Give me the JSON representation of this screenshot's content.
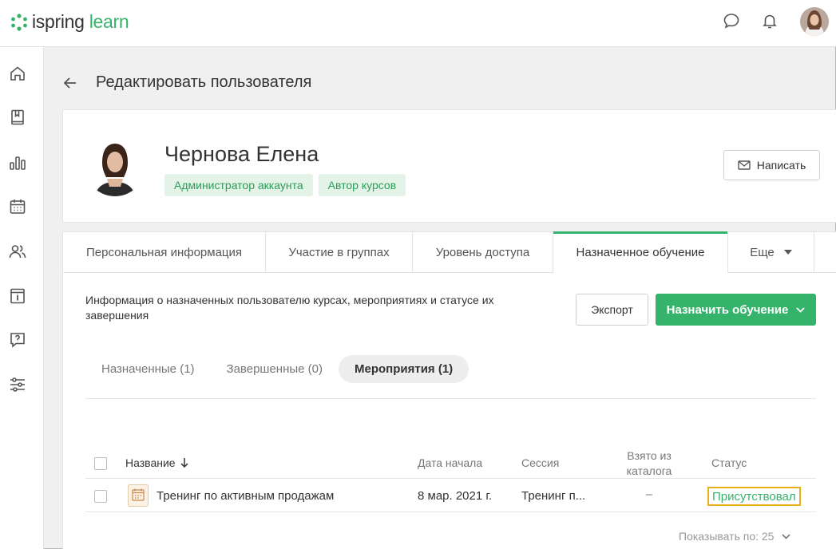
{
  "app": {
    "logo_part1": "ispring",
    "logo_part2": "learn",
    "brand_color": "#36b36b"
  },
  "topbar": {
    "icons": [
      "chat-icon",
      "bell-icon",
      "user-avatar"
    ]
  },
  "sidebar": {
    "icons": [
      "home-icon",
      "book-icon",
      "chart-icon",
      "calendar-icon",
      "users-icon",
      "info-icon",
      "question-icon",
      "settings-icon"
    ]
  },
  "page": {
    "title": "Редактировать пользователя"
  },
  "profile": {
    "name": "Чернова Елена",
    "roles": [
      "Администратор аккаунта",
      "Автор курсов"
    ],
    "write_label": "Написать"
  },
  "tabs": [
    {
      "label": "Персональная информация"
    },
    {
      "label": "Участие в группах"
    },
    {
      "label": "Уровень доступа"
    },
    {
      "label": "Назначенное обучение"
    },
    {
      "label": "Еще"
    }
  ],
  "assigned": {
    "info": "Информация о назначенных пользователю курсах, мероприятиях и статусе их завершения",
    "export_label": "Экспорт",
    "assign_label": "Назначить обучение",
    "subtabs": [
      "Назначенные (1)",
      "Завершенные (0)",
      "Мероприятия (1)"
    ],
    "columns": {
      "name": "Название",
      "start": "Дата начала",
      "session": "Сессия",
      "catalog_line1": "Взято из",
      "catalog_line2": "каталога",
      "status": "Статус"
    },
    "rows": [
      {
        "name": "Тренинг по активным продажам",
        "start": "8 мар. 2021 г.",
        "session": "Тренинг п...",
        "catalog": "–",
        "status": "Присутствовал"
      }
    ],
    "pager": "Показывать по: 25"
  }
}
